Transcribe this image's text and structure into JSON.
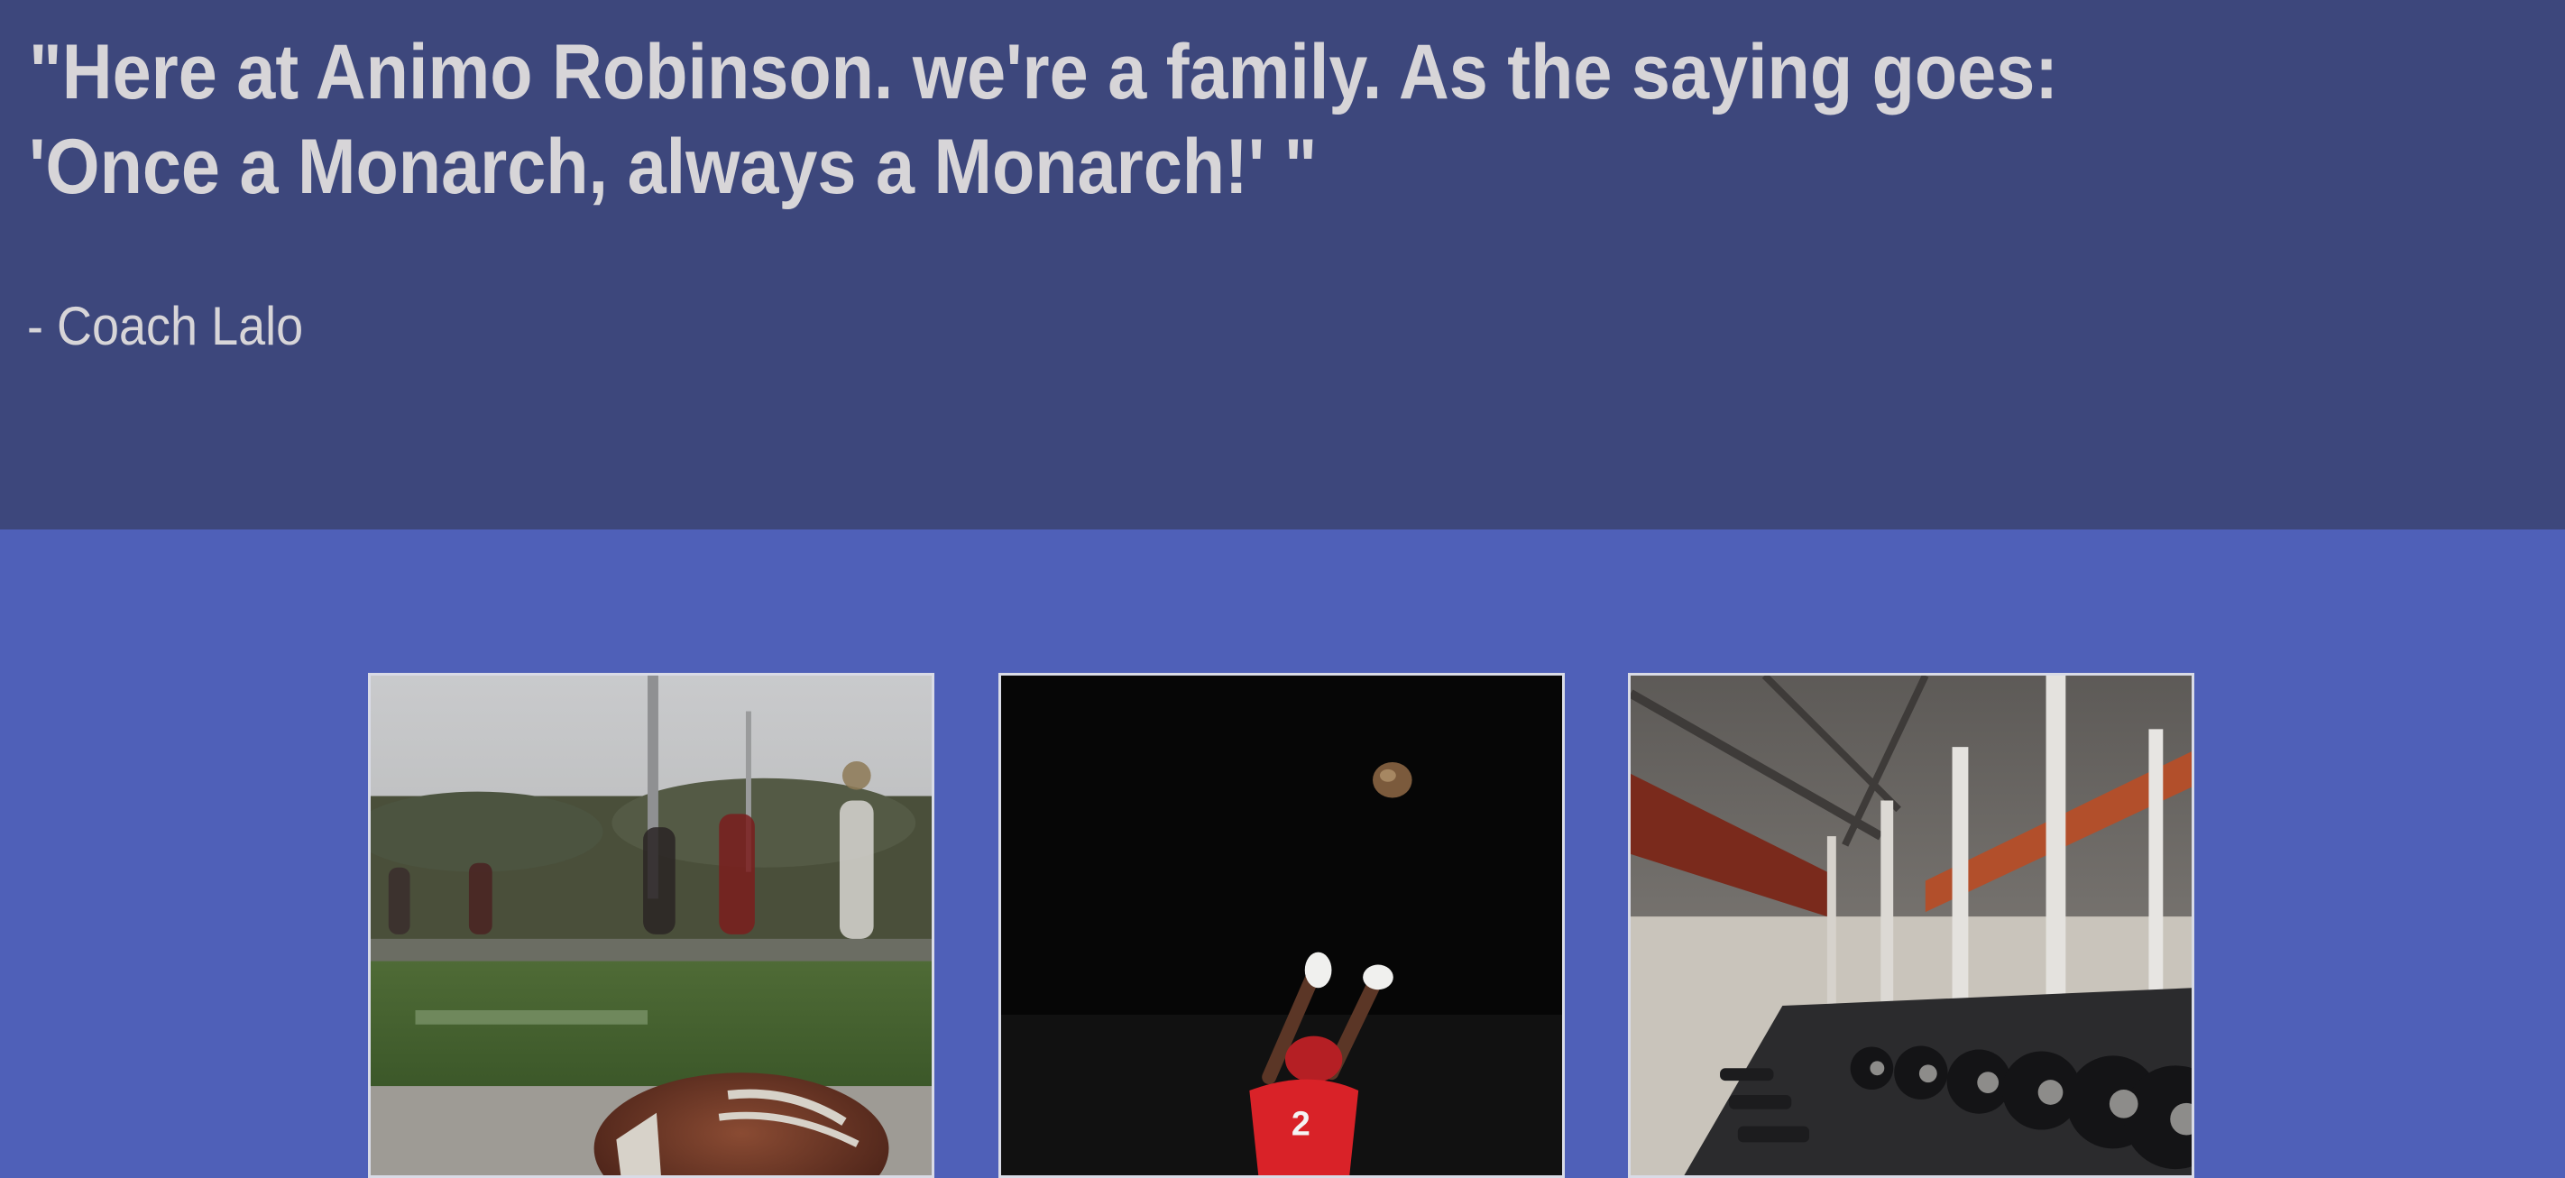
{
  "quote": {
    "text": "\"Here at Animo Robinson. we're a family. As the saying goes: 'Once a Monarch, always a Monarch!' \"",
    "author": "- Coach Lalo"
  },
  "gallery": {
    "photos": [
      {
        "subject": "football-on-field-photo"
      },
      {
        "subject": "receiver-catching-football-photo"
      },
      {
        "subject": "weight-room-dumbbells-photo"
      }
    ]
  },
  "colors": {
    "quote_background": "#3d477c",
    "page_background": "#4f60b8",
    "text": "#d7d5d8",
    "photo_border": "#d9dbe6"
  }
}
